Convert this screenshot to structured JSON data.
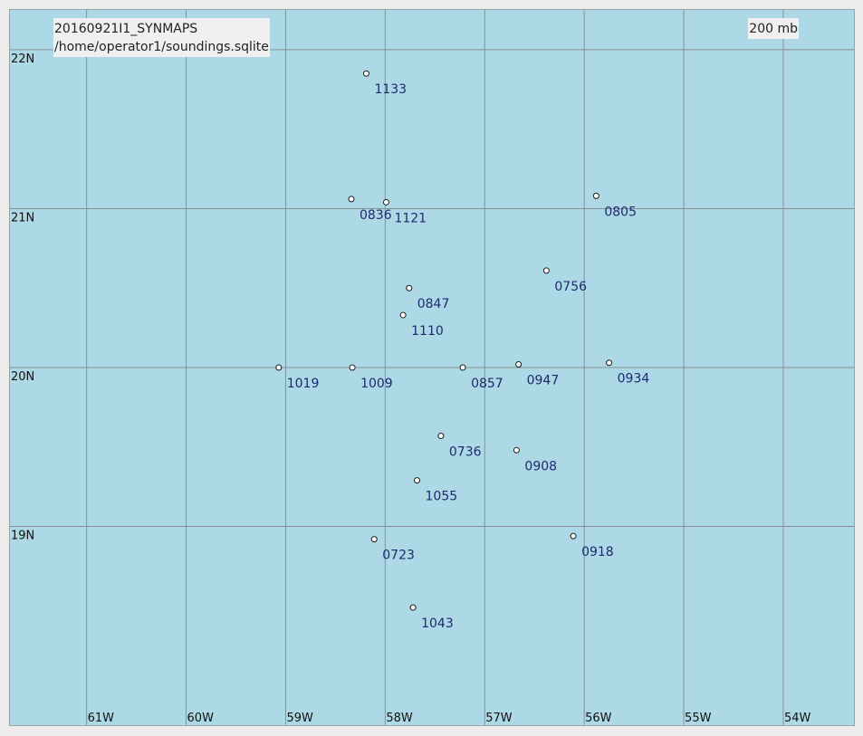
{
  "header": {
    "mission": "20160921I1_SYNMAPS",
    "database": "/home/operator1/soundings.sqlite"
  },
  "level": "200 mb",
  "colors": {
    "ocean": "#add8e6",
    "grid": "#8c8f92",
    "station_label": "#1e2a6e"
  },
  "map": {
    "lon_range": [
      -61.77,
      -53.29
    ],
    "lat_range": [
      17.75,
      22.25
    ],
    "longitudes": [
      {
        "value": -61,
        "label": "61W"
      },
      {
        "value": -60,
        "label": "60W"
      },
      {
        "value": -59,
        "label": "59W"
      },
      {
        "value": -58,
        "label": "58W"
      },
      {
        "value": -57,
        "label": "57W"
      },
      {
        "value": -56,
        "label": "56W"
      },
      {
        "value": -55,
        "label": "55W"
      },
      {
        "value": -54,
        "label": "54W"
      }
    ],
    "latitudes": [
      {
        "value": 22,
        "label": "22N"
      },
      {
        "value": 21,
        "label": "21N"
      },
      {
        "value": 20,
        "label": "20N"
      },
      {
        "value": 19,
        "label": "19N"
      }
    ],
    "stations": [
      {
        "label": "1133",
        "lon": -58.19,
        "lat": 21.85
      },
      {
        "label": "0836",
        "lon": -58.34,
        "lat": 21.06
      },
      {
        "label": "1121",
        "lon": -57.99,
        "lat": 21.04
      },
      {
        "label": "0805",
        "lon": -55.88,
        "lat": 21.08
      },
      {
        "label": "0756",
        "lon": -56.38,
        "lat": 20.61
      },
      {
        "label": "0847",
        "lon": -57.76,
        "lat": 20.5
      },
      {
        "label": "1110",
        "lon": -57.82,
        "lat": 20.33
      },
      {
        "label": "1019",
        "lon": -59.07,
        "lat": 20.0
      },
      {
        "label": "1009",
        "lon": -58.33,
        "lat": 20.0
      },
      {
        "label": "0857",
        "lon": -57.22,
        "lat": 20.0
      },
      {
        "label": "0947",
        "lon": -56.66,
        "lat": 20.02
      },
      {
        "label": "0934",
        "lon": -55.75,
        "lat": 20.03
      },
      {
        "label": "0736",
        "lon": -57.44,
        "lat": 19.57
      },
      {
        "label": "0908",
        "lon": -56.68,
        "lat": 19.48
      },
      {
        "label": "1055",
        "lon": -57.68,
        "lat": 19.29
      },
      {
        "label": "0723",
        "lon": -58.11,
        "lat": 18.92
      },
      {
        "label": "0918",
        "lon": -56.11,
        "lat": 18.94
      },
      {
        "label": "1043",
        "lon": -57.72,
        "lat": 18.49
      }
    ]
  }
}
